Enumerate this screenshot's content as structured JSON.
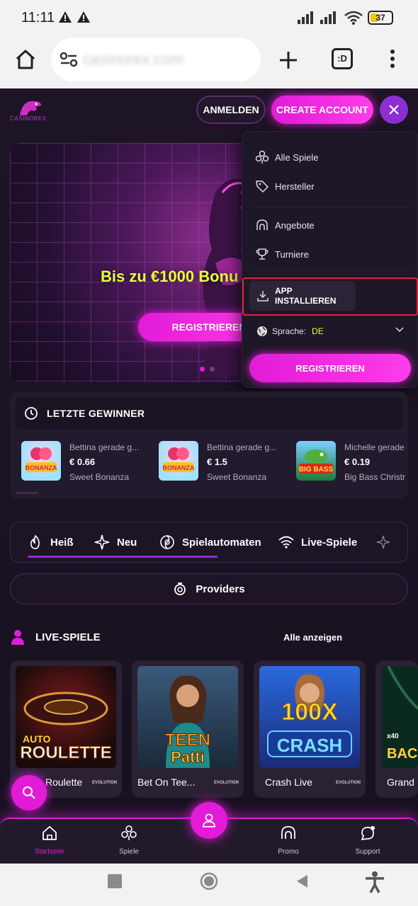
{
  "status_bar": {
    "time": "11:11",
    "battery": "37",
    "battery_level": 0.37
  },
  "browser": {
    "url": "casinorex.com",
    "tab_count": ":D"
  },
  "site": {
    "logo_text": "CASINOREX",
    "login_label": "ANMELDEN",
    "create_account_label": "CREATE ACCOUNT"
  },
  "hero": {
    "title": "Bis zu €1000 Bonu",
    "register_label": "REGISTRIEREN"
  },
  "menu": {
    "items": [
      {
        "label": "Alle Spiele",
        "icon": "games-icon"
      },
      {
        "label": "Hersteller",
        "icon": "tag-icon"
      },
      {
        "label": "Angebote",
        "icon": "offers-icon"
      },
      {
        "label": "Turniere",
        "icon": "trophy-icon"
      }
    ],
    "install_label": "APP INSTALLIEREN",
    "language_label": "Sprache:",
    "language_value": "DE",
    "register_label": "REGISTRIEREN"
  },
  "winners": {
    "title": "LETZTE GEWINNER",
    "items": [
      {
        "player": "Bettina gerade g...",
        "amount": "€ 0.66",
        "game": "Sweet Bonanza"
      },
      {
        "player": "Bettina gerade g...",
        "amount": "€ 1.5",
        "game": "Sweet Bonanza"
      },
      {
        "player": "Michelle gerade",
        "amount": "€ 0.19",
        "game": "Big Bass Christr"
      }
    ]
  },
  "categories": [
    {
      "label": "Heiß",
      "icon": "fire-icon"
    },
    {
      "label": "Neu",
      "icon": "sparkle-icon"
    },
    {
      "label": "Spielautomaten",
      "icon": "slots-icon"
    },
    {
      "label": "Live-Spiele",
      "icon": "wifi-icon"
    }
  ],
  "providers_label": "Providers",
  "live": {
    "title": "LIVE-SPIELE",
    "see_all": "Alle anzeigen",
    "games": [
      {
        "label": "Roulette",
        "art_top": "AUTO",
        "art_main": "ROULETTE",
        "provider": "EVOLUTION"
      },
      {
        "label": "Bet On Tee...",
        "art_top": "TEEN",
        "art_main": "Patti",
        "provider": "EVOLUTION"
      },
      {
        "label": "Crash Live",
        "art_top": "100X",
        "art_main": "CRASH",
        "provider": "EVOLUTION"
      },
      {
        "label": "Grand",
        "art_top": "x40",
        "art_main": "BAC",
        "provider": ""
      }
    ]
  },
  "bottom_nav": [
    {
      "label": "Startseite",
      "icon": "home-icon",
      "active": true
    },
    {
      "label": "Spiele",
      "icon": "games-icon"
    },
    {
      "label": "Promo",
      "icon": "promo-icon"
    },
    {
      "label": "Support",
      "icon": "chat-icon"
    }
  ],
  "colors": {
    "accent": "#e21bd8",
    "purple": "#8b2ed3",
    "highlight": "#e6ff3a",
    "frame": "#e0233e"
  }
}
